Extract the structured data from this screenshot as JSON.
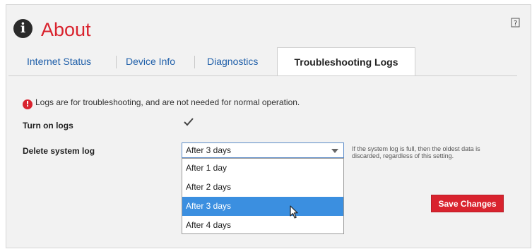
{
  "header": {
    "title": "About",
    "info_icon_glyph": "i",
    "help_icon": "help-question-icon"
  },
  "tabs": [
    {
      "label": "Internet Status",
      "active": false
    },
    {
      "label": "Device Info",
      "active": false
    },
    {
      "label": "Diagnostics",
      "active": false
    },
    {
      "label": "Troubleshooting Logs",
      "active": true
    }
  ],
  "notice": {
    "icon": "alert-icon",
    "text": "Logs are for troubleshooting, and are not needed for normal operation."
  },
  "settings": {
    "turn_on_logs": {
      "label": "Turn on logs",
      "checked": true
    },
    "delete_system_log": {
      "label": "Delete system log",
      "selected": "After 3 days",
      "options": [
        "After 1 day",
        "After 2 days",
        "After 3 days",
        "After 4 days"
      ],
      "highlighted_option": "After 3 days",
      "hint": "If the system log is full, then the oldest data is discarded, regardless of this setting."
    }
  },
  "actions": {
    "save_label": "Save Changes"
  },
  "colors": {
    "brand_red": "#d9232e",
    "link_blue": "#1f5fa9",
    "highlight_blue": "#3b8fe0"
  }
}
